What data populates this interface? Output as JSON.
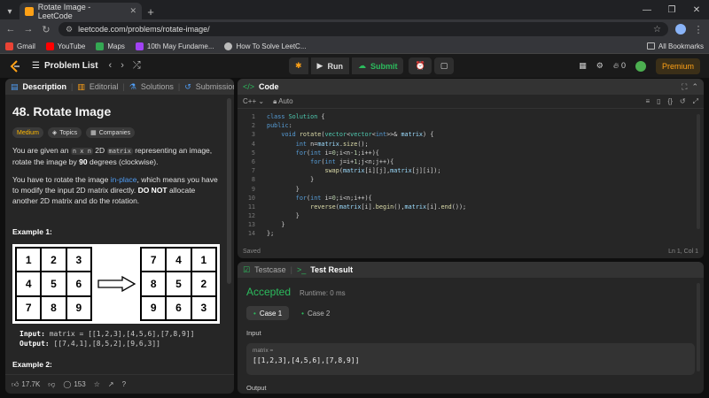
{
  "browser": {
    "tab_title": "Rotate Image - LeetCode",
    "url": "leetcode.com/problems/rotate-image/",
    "bookmarks": [
      "Gmail",
      "YouTube",
      "Maps",
      "10th May Fundame...",
      "How To Solve LeetC..."
    ],
    "all_bookmarks": "All Bookmarks"
  },
  "nav": {
    "problem_list": "Problem List",
    "run": "Run",
    "submit": "Submit",
    "streak": "0",
    "premium": "Premium"
  },
  "left_panel": {
    "tabs": [
      "Description",
      "Editorial",
      "Solutions",
      "Submissions"
    ],
    "title": "48. Rotate Image",
    "tags": [
      "Medium",
      "Topics",
      "Companies"
    ],
    "desc1_a": "You are given an ",
    "desc1_code1": "n x n",
    "desc1_b": " 2D ",
    "desc1_code2": "matrix",
    "desc1_c": " representing an image, rotate the image by ",
    "desc1_bold": "90",
    "desc1_d": " degrees (clockwise).",
    "desc2_a": "You have to rotate the image ",
    "desc2_link": "in-place",
    "desc2_b": ", which means you have to modify the input 2D matrix directly. ",
    "desc2_bold": "DO NOT",
    "desc2_c": " allocate another 2D matrix and do the rotation.",
    "example1_title": "Example 1:",
    "grid_before": [
      "1",
      "2",
      "3",
      "4",
      "5",
      "6",
      "7",
      "8",
      "9"
    ],
    "grid_after": [
      "7",
      "4",
      "1",
      "8",
      "5",
      "2",
      "9",
      "6",
      "3"
    ],
    "input_label": "Input:",
    "input_value": "matrix = [[1,2,3],[4,5,6],[7,8,9]]",
    "output_label": "Output:",
    "output_value": "[[7,4,1],[8,5,2],[9,6,3]]",
    "example2_title": "Example 2:",
    "likes": "17.7K",
    "comments": "153"
  },
  "code_panel": {
    "title": "Code",
    "language": "C++",
    "auto": "Auto",
    "lines": [
      "class Solution {",
      "public:",
      "    void rotate(vector<vector<int>>& matrix) {",
      "        int n=matrix.size();",
      "        for(int i=0;i<n-1;i++){",
      "            for(int j=i+1;j<n;j++){",
      "                swap(matrix[i][j],matrix[j][i]);",
      "            }",
      "        }",
      "        for(int i=0;i<n;i++){",
      "            reverse(matrix[i].begin(),matrix[i].end());",
      "        }",
      "    }",
      "};"
    ],
    "saved": "Saved",
    "cursor": "Ln 1, Col 1"
  },
  "result_panel": {
    "tabs": [
      "Testcase",
      "Test Result"
    ],
    "status": "Accepted",
    "runtime": "Runtime: 0 ms",
    "cases": [
      "Case 1",
      "Case 2"
    ],
    "input_label": "Input",
    "param_name": "matrix =",
    "param_value": "[[1,2,3],[4,5,6],[7,8,9]]",
    "output_label": "Output"
  },
  "colors": {
    "accent_orange": "#ffa116",
    "accepted_green": "#2cbb5d",
    "link_blue": "#4f9df5"
  }
}
